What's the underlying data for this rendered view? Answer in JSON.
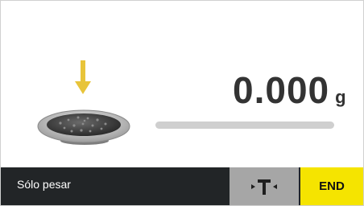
{
  "weighing": {
    "value": "0.000",
    "unit": "g",
    "progress_fraction": 0
  },
  "footer": {
    "mode_label": "Sólo pesar",
    "tare_icon": "tare-icon",
    "end_label": "END"
  },
  "icons": {
    "arrow": "down-arrow-icon",
    "dish": "weighing-dish-icon"
  },
  "colors": {
    "accent_yellow": "#f5e400",
    "arrow_yellow": "#e8c43a",
    "bar_dark": "#222527",
    "tare_gray": "#a6a6a6",
    "text_dark": "#333333"
  }
}
